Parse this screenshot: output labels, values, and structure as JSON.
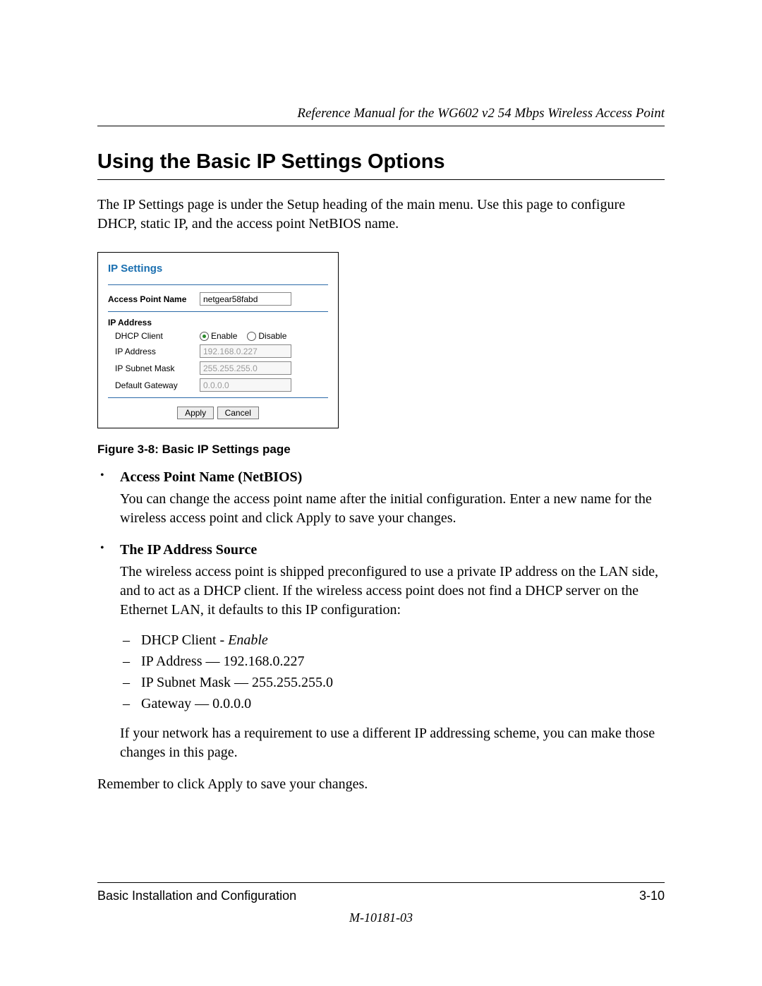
{
  "header": {
    "running": "Reference Manual for the WG602 v2 54 Mbps Wireless Access Point"
  },
  "section": {
    "title": "Using the Basic IP Settings Options",
    "intro": "The IP Settings page is under the Setup heading of the main menu. Use this page to configure DHCP, static IP, and the access point NetBIOS name."
  },
  "figure": {
    "panel_title": "IP Settings",
    "apn_label": "Access Point Name",
    "apn_value": "netgear58fabd",
    "group_title": "IP Address",
    "dhcp_label": "DHCP Client",
    "dhcp_enable": "Enable",
    "dhcp_disable": "Disable",
    "ip_label": "IP Address",
    "ip_value": "192.168.0.227",
    "mask_label": "IP Subnet Mask",
    "mask_value": "255.255.255.0",
    "gw_label": "Default Gateway",
    "gw_value": "0.0.0.0",
    "apply": "Apply",
    "cancel": "Cancel",
    "caption": "Figure 3-8: Basic IP Settings page"
  },
  "bullets": [
    {
      "title": "Access Point Name (NetBIOS)",
      "para": "You can change the access point name after the initial configuration. Enter a new name for the wireless access point and click Apply to save your changes."
    },
    {
      "title": "The IP Address Source",
      "para": "The wireless access point is shipped preconfigured to use a private IP address on the LAN side, and to act as a DHCP client. If the wireless access point does not find a DHCP server on the Ethernet LAN, it defaults to this IP configuration:",
      "dashes": [
        {
          "label": "DHCP Client - ",
          "italic": "Enable"
        },
        {
          "label": "IP Address — 192.168.0.227"
        },
        {
          "label": "IP Subnet Mask — 255.255.255.0"
        },
        {
          "label": "Gateway — 0.0.0.0"
        }
      ],
      "after": "If your network has a requirement to use a different IP addressing scheme, you can make those changes in this page."
    }
  ],
  "remember": "Remember to click Apply to save your changes.",
  "footer": {
    "left": "Basic Installation and Configuration",
    "right": "3-10",
    "docnum": "M-10181-03"
  }
}
